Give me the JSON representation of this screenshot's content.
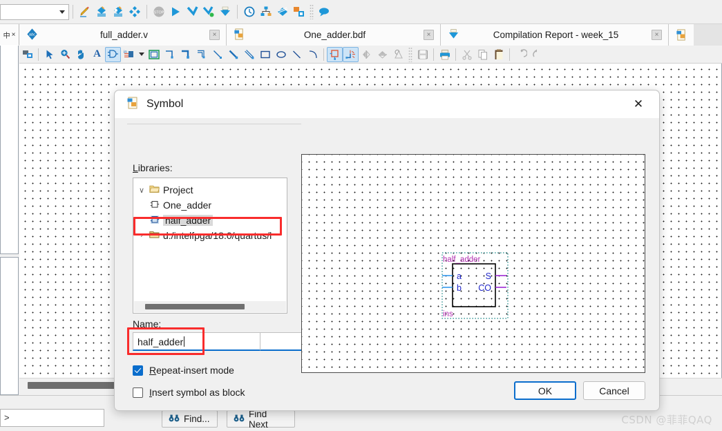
{
  "top_toolbar": {
    "combo_value": "",
    "icons": [
      {
        "name": "pencil-edit-icon"
      },
      {
        "name": "analysis-synthesis-icon"
      },
      {
        "name": "compile-design-icon"
      },
      {
        "name": "fitter-icon"
      },
      {
        "name": "stop-icon"
      },
      {
        "name": "start-compilation-icon"
      },
      {
        "name": "start-analysis-elaboration-icon"
      },
      {
        "name": "start-analysis-synthesis-icon"
      },
      {
        "name": "programmer-icon"
      },
      {
        "name": "timing-analyzer-icon"
      },
      {
        "name": "pin-planner-icon"
      },
      {
        "name": "signaltap-icon"
      },
      {
        "name": "platform-designer-icon"
      },
      {
        "name": "comment-balloon-icon"
      }
    ]
  },
  "left_dock": {
    "pin_label": "中",
    "close_label": "×"
  },
  "tabs": [
    {
      "label": "full_adder.v",
      "icon": "verilog-file-icon",
      "close": "×",
      "active": false
    },
    {
      "label": "One_adder.bdf",
      "icon": "bdf-file-icon",
      "close": "×",
      "active": true
    },
    {
      "label": "Compilation Report - week_15",
      "icon": "compilation-report-icon",
      "close": "×",
      "active": false
    }
  ],
  "tab_overflow": {
    "icon": "new-bdf-icon"
  },
  "draw_toolbar": {
    "tools": [
      {
        "name": "insert-symbol-tool",
        "selected": false
      },
      {
        "name": "select-arrow-tool",
        "selected": false
      },
      {
        "name": "zoom-tool",
        "selected": false
      },
      {
        "name": "hand-pan-tool",
        "selected": false
      },
      {
        "name": "text-tool",
        "selected": false
      },
      {
        "name": "symbol-tool",
        "selected": true
      },
      {
        "name": "pin-tool",
        "selected": false
      },
      {
        "name": "pin-dropdown-caret",
        "selected": false
      },
      {
        "name": "block-tool",
        "selected": false
      },
      {
        "name": "orthogonal-node-line-tool",
        "selected": false
      },
      {
        "name": "orthogonal-bus-line-tool",
        "selected": false
      },
      {
        "name": "orthogonal-conduit-line-tool",
        "selected": false
      },
      {
        "name": "diagonal-node-line-tool",
        "selected": false
      },
      {
        "name": "diagonal-bus-line-tool",
        "selected": false
      },
      {
        "name": "diagonal-conduit-line-tool",
        "selected": false
      },
      {
        "name": "rectangle-tool",
        "selected": false
      },
      {
        "name": "ellipse-tool",
        "selected": false
      },
      {
        "name": "line-tool",
        "selected": false
      },
      {
        "name": "arc-tool",
        "selected": false
      },
      {
        "name": "rubberbanding-tool",
        "selected": true
      },
      {
        "name": "partial-line-selection-tool",
        "selected": true
      },
      {
        "name": "flip-horizontal-tool",
        "selected": false
      },
      {
        "name": "flip-vertical-tool",
        "selected": false
      },
      {
        "name": "rotate-tool",
        "selected": false
      },
      {
        "name": "save-icon",
        "selected": false
      },
      {
        "name": "print-icon",
        "selected": false
      },
      {
        "name": "cut-icon",
        "selected": false
      },
      {
        "name": "copy-icon",
        "selected": false
      },
      {
        "name": "paste-icon",
        "selected": false
      },
      {
        "name": "undo-icon",
        "selected": false
      },
      {
        "name": "redo-icon",
        "selected": false
      }
    ]
  },
  "dialog": {
    "title": "Symbol",
    "title_icon": "symbol-dialog-icon",
    "close_label": "✕",
    "libraries_label": "Libraries:",
    "tree": [
      {
        "label": "Project",
        "depth": 0,
        "expander": "∨",
        "icon": "open-folder-icon",
        "selected": false
      },
      {
        "label": "One_adder",
        "depth": 1,
        "expander": "",
        "icon": "symbol-block-icon",
        "selected": false
      },
      {
        "label": "half_adder",
        "depth": 1,
        "expander": "",
        "icon": "symbol-block-icon",
        "selected": true
      },
      {
        "label": "d:/intelfpga/18.0/quartus/l",
        "depth": 0,
        "expander": "›",
        "icon": "closed-folder-icon",
        "selected": false
      }
    ],
    "name_label": "Name:",
    "name_value": "half_adder",
    "browse_label": "...",
    "checkboxes": [
      {
        "label": "Repeat-insert mode",
        "checked": true,
        "underline_index": 0
      },
      {
        "label": "Insert symbol as block",
        "checked": false,
        "underline_index": 0
      }
    ],
    "ok_label": "OK",
    "cancel_label": "Cancel",
    "preview": {
      "block_title": "half_adder",
      "instance_name": "ins",
      "inputs": [
        "a",
        "b"
      ],
      "outputs": [
        "S",
        "CO"
      ],
      "colors": {
        "block_title": "#b02fb0",
        "instance": "#b02fb0",
        "port_label": "#2026c8",
        "input_wire": "#3399ee",
        "output_wire": "#9c2ad6",
        "dashed_bound": "#1f8a8a",
        "body": "#000000"
      }
    }
  },
  "bottom": {
    "console_value": ">",
    "find_label": "Find...",
    "find_next_label": "Find Next",
    "find_icon": "binoculars-icon"
  },
  "watermark": "CSDN @菲菲QAQ",
  "colors": {
    "accent": "#0a6dcc",
    "highlight_red": "#f92c2c",
    "selection_blue": "#cce4f7",
    "dialog_bg": "#f0f0f0"
  }
}
